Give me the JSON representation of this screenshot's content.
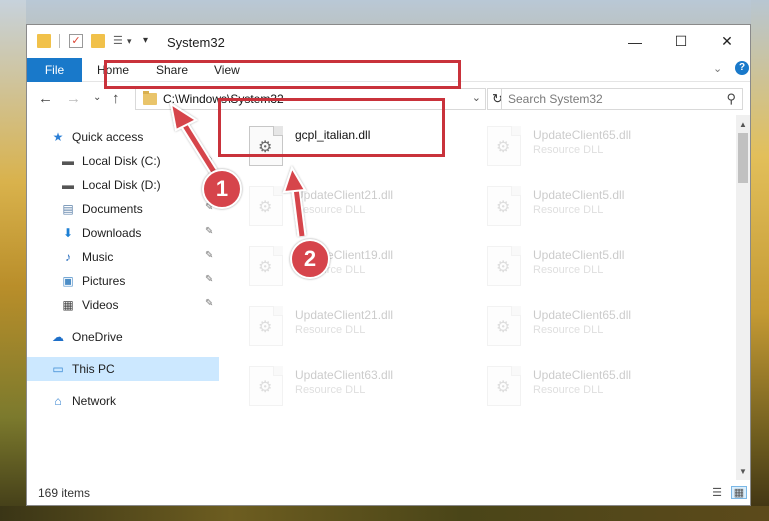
{
  "window": {
    "title": "System32"
  },
  "window_buttons": {
    "minimize": "—",
    "maximize": "☐",
    "close": "✕"
  },
  "ribbon": {
    "tabs": [
      "File",
      "Home",
      "Share",
      "View"
    ],
    "collapse": "⌄",
    "help": "?"
  },
  "navbar": {
    "back": "←",
    "forward": "→",
    "recent": "⌄",
    "up": "↑",
    "address": "C:\\Windows\\System32",
    "address_chevron": "⌄",
    "refresh": "↻",
    "search_placeholder": "Search System32",
    "search_icon": "⚲"
  },
  "sidebar": {
    "items": [
      {
        "label": "Quick access",
        "icon": "star-icon",
        "glyph": "★",
        "color": "#2b7fd6",
        "pinned": false,
        "indent": 0
      },
      {
        "label": "Local Disk (C:)",
        "icon": "drive-icon",
        "glyph": "▬",
        "color": "#555555",
        "pinned": true,
        "indent": 1
      },
      {
        "label": "Local Disk (D:)",
        "icon": "drive-icon",
        "glyph": "▬",
        "color": "#555555",
        "pinned": false,
        "indent": 1
      },
      {
        "label": "Documents",
        "icon": "documents-icon",
        "glyph": "▤",
        "color": "#5a7fa8",
        "pinned": true,
        "indent": 1
      },
      {
        "label": "Downloads",
        "icon": "downloads-icon",
        "glyph": "⬇",
        "color": "#1c7fd4",
        "pinned": true,
        "indent": 1
      },
      {
        "label": "Music",
        "icon": "music-icon",
        "glyph": "♪",
        "color": "#2a6fbf",
        "pinned": true,
        "indent": 1
      },
      {
        "label": "Pictures",
        "icon": "pictures-icon",
        "glyph": "▣",
        "color": "#4d8ec7",
        "pinned": true,
        "indent": 1
      },
      {
        "label": "Videos",
        "icon": "videos-icon",
        "glyph": "▦",
        "color": "#444444",
        "pinned": true,
        "indent": 1
      },
      {
        "label": "OneDrive",
        "icon": "onedrive-icon",
        "glyph": "☁",
        "color": "#1e6fc8",
        "pinned": false,
        "indent": 0
      },
      {
        "label": "This PC",
        "icon": "this-pc-icon",
        "glyph": "▭",
        "color": "#3a8ad4",
        "pinned": false,
        "indent": 0,
        "selected": true
      },
      {
        "label": "Network",
        "icon": "network-icon",
        "glyph": "⌂",
        "color": "#2f7fcf",
        "pinned": false,
        "indent": 0
      }
    ],
    "pin_glyph": "✎"
  },
  "files": [
    {
      "name": "gcpl_italian.dll",
      "type": "",
      "faded": false
    },
    {
      "name": "UpdateClient65.dll",
      "type": "Resource DLL",
      "faded": true
    },
    {
      "name": "UpdateClient21.dll",
      "type": "Resource DLL",
      "faded": true
    },
    {
      "name": "UpdateClient5.dll",
      "type": "Resource DLL",
      "faded": true
    },
    {
      "name": "UpdateClient19.dll",
      "type": "Resource DLL",
      "faded": true
    },
    {
      "name": "UpdateClient5.dll",
      "type": "Resource DLL",
      "faded": true
    },
    {
      "name": "UpdateClient21.dll",
      "type": "Resource DLL",
      "faded": true
    },
    {
      "name": "UpdateClient65.dll",
      "type": "Resource DLL",
      "faded": true
    },
    {
      "name": "UpdateClient63.dll",
      "type": "Resource DLL",
      "faded": true
    },
    {
      "name": "UpdateClient65.dll",
      "type": "Resource DLL",
      "faded": true
    }
  ],
  "status": {
    "item_count": "169 items"
  },
  "scrollbar": {
    "up": "▲",
    "down": "▼"
  },
  "view_buttons": {
    "details": "☰",
    "large_icons": "▦"
  },
  "callouts": [
    {
      "label": "1"
    },
    {
      "label": "2"
    }
  ],
  "colors": {
    "accent": "#1979ca",
    "highlight": "#c9323b",
    "callout": "#d6444b",
    "selection": "#cce8ff"
  }
}
